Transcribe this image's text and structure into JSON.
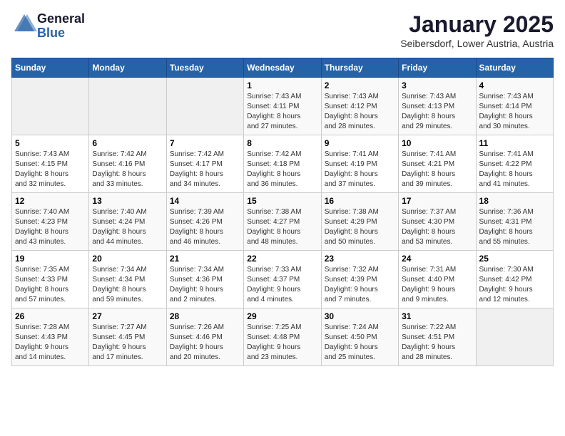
{
  "logo": {
    "line1": "General",
    "line2": "Blue"
  },
  "title": "January 2025",
  "subtitle": "Seibersdorf, Lower Austria, Austria",
  "days_header": [
    "Sunday",
    "Monday",
    "Tuesday",
    "Wednesday",
    "Thursday",
    "Friday",
    "Saturday"
  ],
  "weeks": [
    [
      {
        "day": "",
        "info": ""
      },
      {
        "day": "",
        "info": ""
      },
      {
        "day": "",
        "info": ""
      },
      {
        "day": "1",
        "info": "Sunrise: 7:43 AM\nSunset: 4:11 PM\nDaylight: 8 hours\nand 27 minutes."
      },
      {
        "day": "2",
        "info": "Sunrise: 7:43 AM\nSunset: 4:12 PM\nDaylight: 8 hours\nand 28 minutes."
      },
      {
        "day": "3",
        "info": "Sunrise: 7:43 AM\nSunset: 4:13 PM\nDaylight: 8 hours\nand 29 minutes."
      },
      {
        "day": "4",
        "info": "Sunrise: 7:43 AM\nSunset: 4:14 PM\nDaylight: 8 hours\nand 30 minutes."
      }
    ],
    [
      {
        "day": "5",
        "info": "Sunrise: 7:43 AM\nSunset: 4:15 PM\nDaylight: 8 hours\nand 32 minutes."
      },
      {
        "day": "6",
        "info": "Sunrise: 7:42 AM\nSunset: 4:16 PM\nDaylight: 8 hours\nand 33 minutes."
      },
      {
        "day": "7",
        "info": "Sunrise: 7:42 AM\nSunset: 4:17 PM\nDaylight: 8 hours\nand 34 minutes."
      },
      {
        "day": "8",
        "info": "Sunrise: 7:42 AM\nSunset: 4:18 PM\nDaylight: 8 hours\nand 36 minutes."
      },
      {
        "day": "9",
        "info": "Sunrise: 7:41 AM\nSunset: 4:19 PM\nDaylight: 8 hours\nand 37 minutes."
      },
      {
        "day": "10",
        "info": "Sunrise: 7:41 AM\nSunset: 4:21 PM\nDaylight: 8 hours\nand 39 minutes."
      },
      {
        "day": "11",
        "info": "Sunrise: 7:41 AM\nSunset: 4:22 PM\nDaylight: 8 hours\nand 41 minutes."
      }
    ],
    [
      {
        "day": "12",
        "info": "Sunrise: 7:40 AM\nSunset: 4:23 PM\nDaylight: 8 hours\nand 43 minutes."
      },
      {
        "day": "13",
        "info": "Sunrise: 7:40 AM\nSunset: 4:24 PM\nDaylight: 8 hours\nand 44 minutes."
      },
      {
        "day": "14",
        "info": "Sunrise: 7:39 AM\nSunset: 4:26 PM\nDaylight: 8 hours\nand 46 minutes."
      },
      {
        "day": "15",
        "info": "Sunrise: 7:38 AM\nSunset: 4:27 PM\nDaylight: 8 hours\nand 48 minutes."
      },
      {
        "day": "16",
        "info": "Sunrise: 7:38 AM\nSunset: 4:29 PM\nDaylight: 8 hours\nand 50 minutes."
      },
      {
        "day": "17",
        "info": "Sunrise: 7:37 AM\nSunset: 4:30 PM\nDaylight: 8 hours\nand 53 minutes."
      },
      {
        "day": "18",
        "info": "Sunrise: 7:36 AM\nSunset: 4:31 PM\nDaylight: 8 hours\nand 55 minutes."
      }
    ],
    [
      {
        "day": "19",
        "info": "Sunrise: 7:35 AM\nSunset: 4:33 PM\nDaylight: 8 hours\nand 57 minutes."
      },
      {
        "day": "20",
        "info": "Sunrise: 7:34 AM\nSunset: 4:34 PM\nDaylight: 8 hours\nand 59 minutes."
      },
      {
        "day": "21",
        "info": "Sunrise: 7:34 AM\nSunset: 4:36 PM\nDaylight: 9 hours\nand 2 minutes."
      },
      {
        "day": "22",
        "info": "Sunrise: 7:33 AM\nSunset: 4:37 PM\nDaylight: 9 hours\nand 4 minutes."
      },
      {
        "day": "23",
        "info": "Sunrise: 7:32 AM\nSunset: 4:39 PM\nDaylight: 9 hours\nand 7 minutes."
      },
      {
        "day": "24",
        "info": "Sunrise: 7:31 AM\nSunset: 4:40 PM\nDaylight: 9 hours\nand 9 minutes."
      },
      {
        "day": "25",
        "info": "Sunrise: 7:30 AM\nSunset: 4:42 PM\nDaylight: 9 hours\nand 12 minutes."
      }
    ],
    [
      {
        "day": "26",
        "info": "Sunrise: 7:28 AM\nSunset: 4:43 PM\nDaylight: 9 hours\nand 14 minutes."
      },
      {
        "day": "27",
        "info": "Sunrise: 7:27 AM\nSunset: 4:45 PM\nDaylight: 9 hours\nand 17 minutes."
      },
      {
        "day": "28",
        "info": "Sunrise: 7:26 AM\nSunset: 4:46 PM\nDaylight: 9 hours\nand 20 minutes."
      },
      {
        "day": "29",
        "info": "Sunrise: 7:25 AM\nSunset: 4:48 PM\nDaylight: 9 hours\nand 23 minutes."
      },
      {
        "day": "30",
        "info": "Sunrise: 7:24 AM\nSunset: 4:50 PM\nDaylight: 9 hours\nand 25 minutes."
      },
      {
        "day": "31",
        "info": "Sunrise: 7:22 AM\nSunset: 4:51 PM\nDaylight: 9 hours\nand 28 minutes."
      },
      {
        "day": "",
        "info": ""
      }
    ]
  ]
}
